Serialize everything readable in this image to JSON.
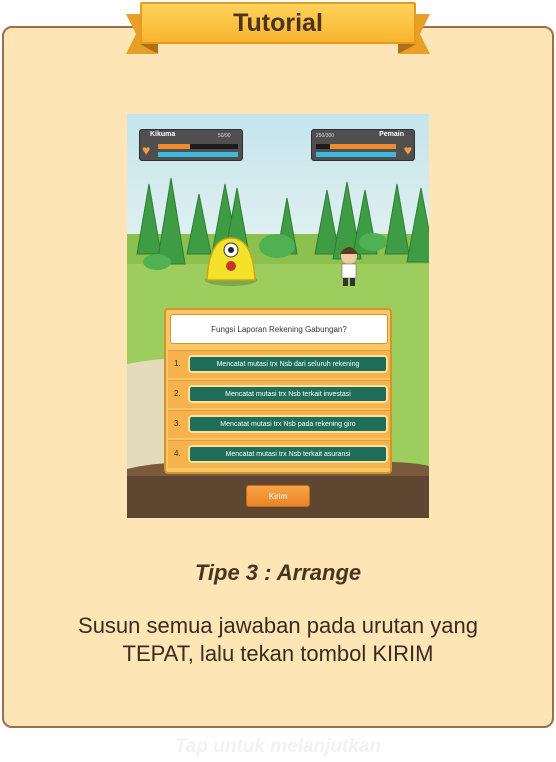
{
  "banner": {
    "title": "Tutorial"
  },
  "game": {
    "enemy": {
      "name": "Kikuma",
      "hp": "50/90"
    },
    "player": {
      "name": "Pemain",
      "hp": "250/300"
    },
    "question": "Fungsi Laporan Rekening Gabungan?",
    "options": [
      {
        "num": "1.",
        "text": "Mencatat mutasi trx Nsb dari seluruh rekening"
      },
      {
        "num": "2.",
        "text": "Mencatat mutasi trx Nsb terkait investasi"
      },
      {
        "num": "3.",
        "text": "Mencatat mutasi trx Nsb pada rekening giro"
      },
      {
        "num": "4.",
        "text": "Mencatat mutasi trx Nsb terkait asuransi"
      }
    ],
    "submit_label": "Kirim"
  },
  "tutorial": {
    "type_title": "Tipe 3 : Arrange",
    "description": "Susun semua jawaban pada urutan yang TEPAT, lalu tekan tombol KIRIM"
  },
  "footer": {
    "tap_hint": "Tap untuk melanjutkan"
  },
  "icons": {
    "hud_left": "heart-icon",
    "hud_right": "heart-icon"
  },
  "colors": {
    "card_bg": "#fde5b5",
    "ribbon": "#f8b42f",
    "option_button": "#1f6e5b",
    "submit": "#e98528"
  }
}
